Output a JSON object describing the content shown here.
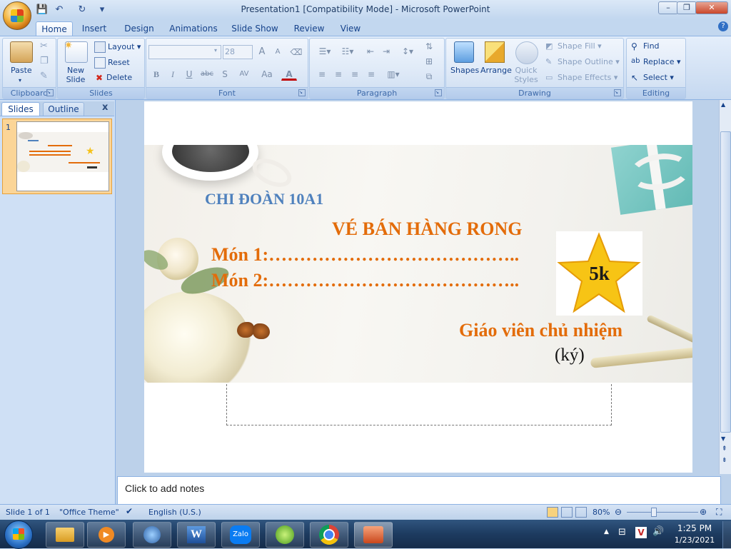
{
  "window": {
    "title": "Presentation1 [Compatibility Mode] - Microsoft PowerPoint",
    "buttons": [
      "–",
      "❐",
      "✕"
    ]
  },
  "qat": {
    "save": "💾",
    "undo": "↶",
    "redo": "↻",
    "customize": "▾"
  },
  "tabs": [
    "Home",
    "Insert",
    "Design",
    "Animations",
    "Slide Show",
    "Review",
    "View"
  ],
  "ribbon": {
    "clipboard": {
      "label": "Clipboard",
      "paste": "Paste"
    },
    "slides": {
      "label": "Slides",
      "new_slide": "New Slide",
      "layout": "Layout",
      "reset": "Reset",
      "delete": "Delete"
    },
    "font": {
      "label": "Font",
      "font_name": "",
      "font_size": "28",
      "bold": "B",
      "italic": "I",
      "underline": "U",
      "strike": "abc",
      "shadow": "S",
      "spacing": "AV",
      "case": "Aa",
      "color": "A",
      "grow": "A",
      "shrink": "A"
    },
    "paragraph": {
      "label": "Paragraph"
    },
    "drawing": {
      "label": "Drawing",
      "shapes": "Shapes",
      "arrange": "Arrange",
      "quick_styles": "Quick Styles",
      "shape_fill": "Shape Fill",
      "shape_outline": "Shape Outline",
      "shape_effects": "Shape Effects"
    },
    "editing": {
      "label": "Editing",
      "find": "Find",
      "replace": "Replace",
      "select": "Select"
    }
  },
  "pane": {
    "tab_slides": "Slides",
    "tab_outline": "Outline",
    "close": "x",
    "slide_number": "1"
  },
  "slide": {
    "org": "CHI ĐOÀN 10A1",
    "title": "VÉ BÁN HÀNG RONG",
    "item1": "Món  1:…………………………………..",
    "item2": "Món  2:…………………………………..",
    "badge": "5k",
    "signer": "Giáo viên  chủ nhiệm",
    "sign": "(ký)"
  },
  "notes": {
    "placeholder": "Click to add notes"
  },
  "status": {
    "slide": "Slide 1 of 1",
    "theme": "\"Office Theme\"",
    "language": "English (U.S.)",
    "zoom": "80%"
  },
  "taskbar": {
    "time": "1:25 PM",
    "date": "1/23/2021",
    "zalo": "Zalo"
  },
  "colors": {
    "slide_blue": "#4f81bd",
    "slide_orange": "#e36c0a",
    "ribbon_text": "#15428b"
  }
}
